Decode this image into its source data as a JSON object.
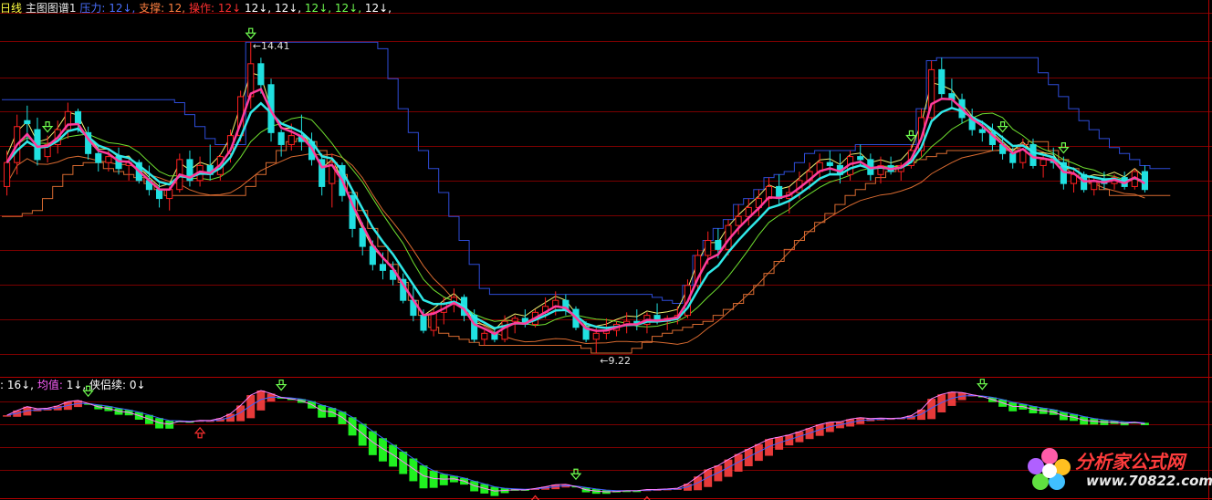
{
  "colors": {
    "background": "#000000",
    "grid": "#7a0000",
    "up_candle": "#ff2020",
    "down_candle": "#20e0e0",
    "bold_ma": "#ff3c9c",
    "cyan_ma": "#30e8e8",
    "yellow_band": "#f0f070",
    "green_band": "#70e030",
    "blue_line": "#2e4cd8",
    "orange_line": "#d86a30",
    "buy_arrow": "#ff3030",
    "sell_arrow": "#70ff50",
    "sub_pink": "#ff80ff",
    "sub_blue": "#4060ff",
    "sub_bar_green": "#20f020",
    "sub_bar_red": "#ff4040"
  },
  "header_main": {
    "period": "日线",
    "title": "主图图谱1",
    "pressure_label": "压力:",
    "pressure_value": "12↓,",
    "support_label": "支撑:",
    "support_value": "12,",
    "operate_label": "操作:",
    "operate_value": "12↓",
    "v1": "12↓,",
    "v2": "12↓,",
    "v3": "12↓,",
    "v4": "12↓,",
    "v5": "12↓,"
  },
  "header_sub": {
    "first_value": ": 16↓,",
    "avg_label": "均值:",
    "avg_value": "1↓,",
    "continue_label": "侠侣续:",
    "continue_value": "0↓"
  },
  "annotations": {
    "high_label": "←14.41",
    "low_label": "←9.22"
  },
  "watermark": {
    "text": "分析家公式网",
    "url": "www.70822.com"
  },
  "chart_data": {
    "type": "candlestick",
    "title": "",
    "ylim": [
      8.9,
      14.9
    ],
    "high": 14.41,
    "low": 9.22,
    "candles": [
      [
        12.0,
        12.6,
        11.85,
        12.4
      ],
      [
        12.4,
        13.2,
        12.2,
        13.0
      ],
      [
        13.1,
        13.35,
        12.75,
        13.05
      ],
      [
        12.95,
        13.15,
        12.35,
        12.45
      ],
      [
        12.5,
        12.85,
        12.4,
        12.7
      ],
      [
        12.7,
        13.1,
        12.55,
        12.95
      ],
      [
        12.95,
        13.4,
        12.8,
        13.25
      ],
      [
        13.25,
        13.3,
        12.9,
        13.05
      ],
      [
        12.9,
        13.0,
        12.45,
        12.55
      ],
      [
        12.55,
        12.7,
        12.25,
        12.4
      ],
      [
        12.4,
        12.6,
        12.25,
        12.5
      ],
      [
        12.5,
        12.65,
        12.2,
        12.3
      ],
      [
        12.35,
        12.5,
        12.1,
        12.4
      ],
      [
        12.4,
        12.45,
        12.05,
        12.1
      ],
      [
        12.1,
        12.35,
        11.85,
        11.95
      ],
      [
        11.95,
        12.05,
        11.65,
        11.8
      ],
      [
        11.8,
        12.0,
        11.6,
        11.95
      ],
      [
        11.95,
        12.55,
        11.9,
        12.45
      ],
      [
        12.45,
        12.6,
        12.0,
        12.1
      ],
      [
        12.1,
        12.5,
        12.0,
        12.35
      ],
      [
        12.35,
        12.7,
        12.1,
        12.2
      ],
      [
        12.2,
        12.55,
        12.1,
        12.5
      ],
      [
        12.55,
        12.95,
        12.4,
        12.85
      ],
      [
        12.85,
        13.6,
        12.75,
        13.5
      ],
      [
        13.5,
        14.41,
        13.3,
        14.05
      ],
      [
        14.05,
        14.15,
        13.55,
        13.7
      ],
      [
        13.7,
        13.8,
        12.75,
        12.9
      ],
      [
        12.9,
        12.95,
        12.5,
        12.7
      ],
      [
        12.7,
        13.05,
        12.6,
        12.85
      ],
      [
        12.85,
        13.2,
        12.6,
        12.75
      ],
      [
        12.75,
        12.9,
        12.35,
        12.45
      ],
      [
        12.45,
        12.55,
        11.85,
        12.0
      ],
      [
        12.05,
        12.55,
        11.65,
        12.4
      ],
      [
        12.35,
        12.4,
        11.75,
        11.85
      ],
      [
        11.85,
        11.95,
        11.15,
        11.3
      ],
      [
        11.3,
        11.4,
        10.85,
        11.0
      ],
      [
        11.0,
        11.1,
        10.6,
        10.7
      ],
      [
        10.7,
        10.9,
        10.45,
        10.6
      ],
      [
        10.6,
        10.75,
        10.35,
        10.45
      ],
      [
        10.45,
        10.55,
        10.05,
        10.1
      ],
      [
        10.1,
        10.35,
        9.75,
        9.85
      ],
      [
        9.85,
        9.95,
        9.55,
        9.6
      ],
      [
        9.6,
        9.95,
        9.5,
        9.9
      ],
      [
        9.9,
        10.15,
        9.7,
        10.05
      ],
      [
        10.05,
        10.3,
        9.9,
        10.15
      ],
      [
        10.15,
        10.2,
        9.75,
        9.85
      ],
      [
        9.85,
        9.95,
        9.4,
        9.45
      ],
      [
        9.45,
        9.6,
        9.35,
        9.55
      ],
      [
        9.55,
        9.65,
        9.4,
        9.45
      ],
      [
        9.45,
        9.85,
        9.4,
        9.75
      ],
      [
        9.75,
        9.85,
        9.55,
        9.8
      ],
      [
        9.8,
        9.95,
        9.65,
        9.7
      ],
      [
        9.7,
        9.95,
        9.65,
        9.9
      ],
      [
        9.9,
        10.15,
        9.8,
        10.0
      ],
      [
        10.0,
        10.25,
        9.85,
        10.1
      ],
      [
        10.1,
        10.2,
        9.85,
        9.95
      ],
      [
        9.95,
        10.0,
        9.6,
        9.65
      ],
      [
        9.65,
        9.75,
        9.4,
        9.45
      ],
      [
        9.45,
        9.65,
        9.22,
        9.55
      ],
      [
        9.55,
        9.8,
        9.45,
        9.6
      ],
      [
        9.6,
        9.75,
        9.5,
        9.7
      ],
      [
        9.7,
        9.9,
        9.55,
        9.75
      ],
      [
        9.75,
        9.95,
        9.6,
        9.7
      ],
      [
        9.7,
        9.9,
        9.55,
        9.85
      ],
      [
        9.85,
        10.05,
        9.7,
        9.75
      ],
      [
        9.75,
        9.85,
        9.6,
        9.8
      ],
      [
        9.8,
        10.0,
        9.7,
        9.85
      ],
      [
        9.85,
        10.45,
        9.8,
        10.35
      ],
      [
        10.35,
        10.95,
        10.25,
        10.85
      ],
      [
        10.85,
        11.25,
        10.7,
        11.1
      ],
      [
        11.1,
        11.3,
        10.8,
        10.95
      ],
      [
        10.95,
        11.45,
        10.85,
        11.35
      ],
      [
        11.35,
        11.7,
        11.2,
        11.5
      ],
      [
        11.5,
        11.8,
        11.35,
        11.65
      ],
      [
        11.65,
        11.95,
        11.5,
        11.8
      ],
      [
        11.8,
        12.15,
        11.65,
        12.0
      ],
      [
        12.0,
        12.2,
        11.7,
        11.8
      ],
      [
        11.8,
        12.0,
        11.55,
        11.9
      ],
      [
        11.9,
        12.25,
        11.8,
        12.1
      ],
      [
        12.1,
        12.4,
        11.95,
        12.25
      ],
      [
        12.25,
        12.55,
        12.1,
        12.4
      ],
      [
        12.4,
        12.6,
        12.2,
        12.35
      ],
      [
        12.35,
        12.55,
        12.05,
        12.2
      ],
      [
        12.2,
        12.6,
        12.1,
        12.5
      ],
      [
        12.5,
        12.7,
        12.35,
        12.45
      ],
      [
        12.45,
        12.55,
        12.1,
        12.2
      ],
      [
        12.2,
        12.5,
        12.05,
        12.35
      ],
      [
        12.35,
        12.5,
        12.2,
        12.25
      ],
      [
        12.25,
        12.4,
        12.1,
        12.35
      ],
      [
        12.35,
        12.7,
        12.3,
        12.6
      ],
      [
        12.6,
        13.3,
        12.5,
        13.15
      ],
      [
        13.15,
        14.1,
        13.05,
        13.95
      ],
      [
        13.95,
        14.15,
        13.45,
        13.55
      ],
      [
        13.55,
        13.8,
        13.3,
        13.45
      ],
      [
        13.45,
        13.55,
        13.05,
        13.15
      ],
      [
        13.15,
        13.3,
        12.85,
        12.95
      ],
      [
        12.95,
        13.1,
        12.75,
        12.9
      ],
      [
        12.9,
        13.05,
        12.6,
        12.7
      ],
      [
        12.7,
        12.85,
        12.45,
        12.55
      ],
      [
        12.55,
        12.65,
        12.3,
        12.4
      ],
      [
        12.4,
        12.8,
        12.3,
        12.7
      ],
      [
        12.7,
        12.8,
        12.3,
        12.35
      ],
      [
        12.35,
        12.55,
        12.15,
        12.45
      ],
      [
        12.45,
        12.65,
        12.3,
        12.4
      ],
      [
        12.4,
        12.5,
        11.95,
        12.05
      ],
      [
        12.05,
        12.3,
        11.9,
        12.2
      ],
      [
        12.2,
        12.25,
        11.9,
        11.95
      ],
      [
        11.95,
        12.15,
        11.85,
        12.1
      ],
      [
        12.1,
        12.25,
        11.95,
        12.05
      ],
      [
        12.05,
        12.2,
        11.95,
        12.15
      ],
      [
        12.15,
        12.25,
        11.95,
        12.0
      ],
      [
        12.0,
        12.3,
        11.95,
        12.25
      ],
      [
        12.25,
        12.35,
        11.9,
        11.95
      ]
    ],
    "lines": {
      "pressure": [
        13.45,
        13.45,
        13.45,
        13.45,
        13.45,
        13.45,
        13.45,
        13.45,
        13.45,
        13.45,
        13.45,
        13.45,
        13.45,
        13.45,
        13.45,
        13.45,
        13.45,
        13.4,
        13.2,
        13.0,
        12.8,
        12.7,
        12.7,
        12.7,
        14.41,
        14.41,
        14.41,
        14.41,
        14.41,
        14.41,
        14.41,
        14.41,
        14.41,
        14.41,
        14.41,
        14.41,
        14.41,
        14.3,
        13.8,
        13.3,
        12.9,
        12.6,
        12.3,
        11.9,
        11.5,
        11.1,
        10.7,
        10.3,
        10.2,
        10.2,
        10.2,
        10.2,
        10.2,
        10.2,
        10.2,
        10.2,
        10.2,
        10.2,
        10.2,
        10.2,
        10.2,
        10.2,
        10.2,
        10.2,
        10.15,
        10.1,
        10.05,
        10.35,
        10.85,
        11.1,
        11.3,
        11.45,
        11.7,
        11.8,
        11.95,
        12.15,
        12.2,
        12.25,
        12.4,
        12.55,
        12.6,
        12.6,
        12.6,
        12.6,
        12.7,
        12.7,
        12.7,
        12.7,
        12.7,
        12.7,
        13.3,
        14.1,
        14.15,
        14.15,
        14.15,
        14.15,
        14.15,
        14.15,
        14.15,
        14.15,
        14.15,
        14.15,
        13.9,
        13.7,
        13.5,
        13.3,
        13.1,
        12.95,
        12.8,
        12.65,
        12.55,
        12.45,
        12.35,
        12.3,
        12.3
      ],
      "support": [
        11.5,
        11.5,
        11.55,
        11.6,
        11.8,
        12.0,
        12.2,
        12.35,
        12.4,
        12.4,
        12.3,
        12.25,
        12.2,
        12.15,
        12.05,
        11.95,
        11.85,
        11.85,
        11.85,
        11.85,
        11.85,
        11.85,
        11.85,
        11.85,
        12.0,
        12.2,
        12.4,
        12.6,
        12.75,
        12.8,
        12.75,
        12.6,
        12.4,
        12.2,
        11.9,
        11.6,
        11.3,
        11.0,
        10.7,
        10.4,
        10.1,
        9.85,
        9.65,
        9.55,
        9.5,
        9.45,
        9.4,
        9.35,
        9.35,
        9.35,
        9.35,
        9.35,
        9.35,
        9.35,
        9.35,
        9.35,
        9.35,
        9.3,
        9.22,
        9.22,
        9.22,
        9.22,
        9.3,
        9.4,
        9.5,
        9.55,
        9.6,
        9.65,
        9.7,
        9.75,
        9.85,
        9.95,
        10.05,
        10.2,
        10.35,
        10.55,
        10.75,
        10.95,
        11.1,
        11.25,
        11.4,
        11.55,
        11.7,
        11.85,
        11.95,
        12.05,
        12.15,
        12.25,
        12.35,
        12.4,
        12.45,
        12.5,
        12.55,
        12.6,
        12.6,
        12.6,
        12.6,
        12.6,
        12.6,
        12.6,
        12.7,
        12.75,
        12.75,
        12.6,
        12.45,
        12.3,
        12.15,
        12.05,
        11.95,
        11.85,
        11.85,
        11.85,
        11.85,
        11.85,
        11.85
      ]
    },
    "buy_markers": [],
    "sell_markers": [
      4,
      24,
      89,
      104,
      98
    ],
    "sub": {
      "ylim": [
        0,
        100
      ]
    }
  }
}
